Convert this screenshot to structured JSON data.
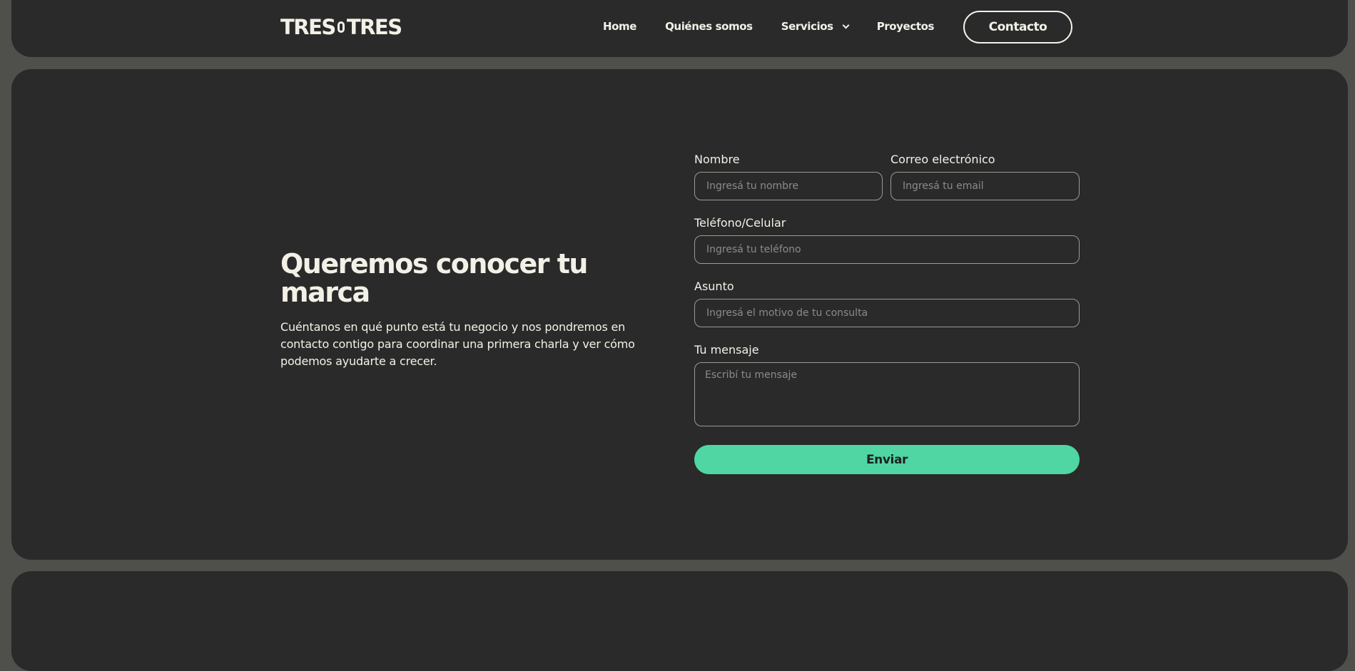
{
  "header": {
    "logo_left": "TRES",
    "logo_right": "TRES",
    "nav": {
      "home": "Home",
      "quienes": "Quiénes somos",
      "servicios": "Servicios",
      "proyectos": "Proyectos"
    },
    "contact_button": "Contacto"
  },
  "hero": {
    "title": "Queremos conocer tu marca",
    "description": "Cuéntanos en qué punto está tu negocio y nos pondremos en contacto contigo para coordinar una primera charla y ver cómo podemos ayudarte a crecer."
  },
  "form": {
    "name": {
      "label": "Nombre",
      "placeholder": "Ingresá tu nombre",
      "value": ""
    },
    "email": {
      "label": "Correo electrónico",
      "placeholder": "Ingresá tu email",
      "value": ""
    },
    "phone": {
      "label": "Teléfono/Celular",
      "placeholder": "Ingresá tu teléfono",
      "value": ""
    },
    "subject": {
      "label": "Asunto",
      "placeholder": "Ingresá el motivo de tu consulta",
      "value": ""
    },
    "message": {
      "label": "Tu mensaje",
      "placeholder": "Escribí tu mensaje",
      "value": ""
    },
    "submit_label": "Enviar"
  },
  "colors": {
    "background": "#4f4f4c",
    "panel": "#2a2a2a",
    "text": "#f3f1e7",
    "accent": "#4fd6a3"
  },
  "icons": {
    "dropdown": "chevron-down-icon"
  }
}
